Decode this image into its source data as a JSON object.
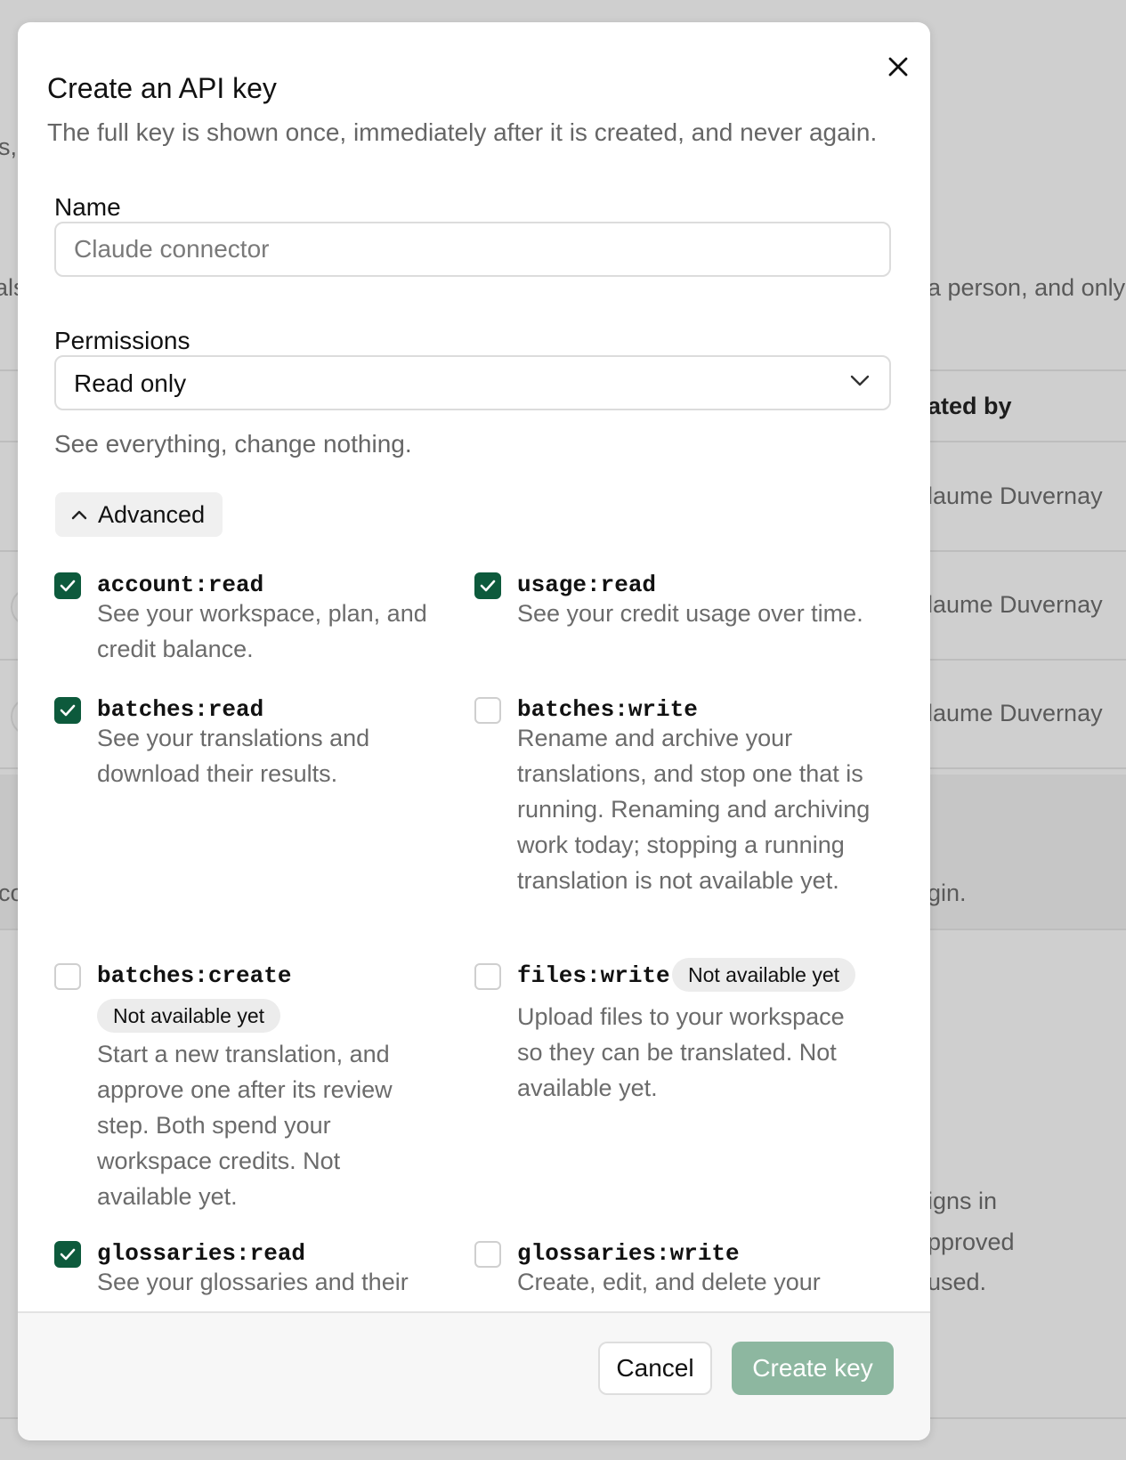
{
  "background": {
    "fragments": [
      "s,",
      "als",
      "a person, and only",
      "ated by",
      "laume Duvernay",
      "laume Duvernay",
      "laume Duvernay",
      "co",
      "gin.",
      "igns in",
      "pproved",
      "used."
    ]
  },
  "modal": {
    "title": "Create an API key",
    "subtitle": "The full key is shown once, immediately after it is created, and never again.",
    "close_icon": "close-icon",
    "name_label": "Name",
    "name_placeholder": "Claude connector",
    "name_value": "",
    "permissions_label": "Permissions",
    "permissions_value": "Read only",
    "permissions_help": "See everything, change nothing.",
    "advanced_label": "Advanced",
    "advanced_icon": "chevron-up-icon",
    "permissions": [
      {
        "code": "account:read",
        "checked": true,
        "description": "See your workspace, plan, and credit balance."
      },
      {
        "code": "usage:read",
        "checked": true,
        "description": "See your credit usage over time."
      },
      {
        "code": "batches:read",
        "checked": true,
        "description": "See your translations and download their results."
      },
      {
        "code": "batches:write",
        "checked": false,
        "description": "Rename and archive your translations, and stop one that is running. Renaming and archiving work today; stopping a running translation is not available yet."
      },
      {
        "code": "batches:create",
        "checked": false,
        "badge": "Not available yet",
        "description": "Start a new translation, and approve one after its review step. Both spend your workspace credits. Not available yet."
      },
      {
        "code": "files:write",
        "checked": false,
        "badge": "Not available yet",
        "description": "Upload files to your workspace so they can be translated. Not available yet."
      },
      {
        "code": "glossaries:read",
        "checked": true,
        "description": "See your glossaries and their"
      },
      {
        "code": "glossaries:write",
        "checked": false,
        "description": "Create, edit, and delete your"
      }
    ],
    "cancel_label": "Cancel",
    "create_label": "Create key",
    "colors": {
      "accent": "#0d5a3c",
      "create_disabled": "#8db7a0"
    }
  }
}
